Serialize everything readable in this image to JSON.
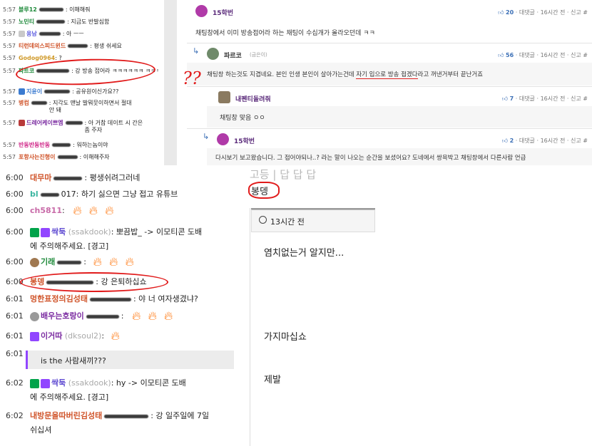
{
  "small_chat": {
    "rows": [
      {
        "time": "5:57",
        "name": "블루12",
        "name_color": "#1e8a3a",
        "msg": ": 이해해줘"
      },
      {
        "time": "5:57",
        "name": "노민티",
        "name_color": "#1e8a3a",
        "msg": ": 지금도 반발심함"
      },
      {
        "time": "5:57",
        "name": "웅남",
        "name_color": "#5b5be0",
        "msg": ": 아 ㅡㅡ"
      },
      {
        "time": "5:57",
        "name": "티런데의스피드윈드",
        "name_color": "#d0542a",
        "msg": ": 평생 쉬세요"
      },
      {
        "time": "5:57",
        "name": "Godog0964",
        "name_color": "#d09a2a",
        "msg": ": ?"
      },
      {
        "time": "5:57",
        "name": "파트코",
        "name_color": "#1e8a3a",
        "msg": ": 강 방송 접어라 ㅋㅋㅋㅋㅋㅋ ㅋㅋㅋ"
      },
      {
        "time": "5:57",
        "name": "지윤이",
        "name_color": "#3b7bd0",
        "msg": ": 공유원이신가요??"
      },
      {
        "time": "5:57",
        "name": "병컴",
        "name_color": "#d0542a",
        "msg": ": 지각도 맨날 발뭐뭇이하면서 절대안 돼"
      },
      {
        "time": "5:57",
        "name": "드레어케이쁘엠",
        "name_color": "#7a2aa0",
        "msg": ": 아 거참 데이트 시 간은 좀 주자"
      },
      {
        "time": "5:57",
        "name": "반동반동반동",
        "name_color": "#d02a8a",
        "msg": ": 워하는놈이야"
      },
      {
        "time": "5:57",
        "name": "포항사는진형이",
        "name_color": "#d0542a",
        "msg": ": 이해해주자"
      }
    ]
  },
  "thread": {
    "comments": [
      {
        "nick": "15학번",
        "likes": "20",
        "reply_label": "대댓글",
        "time": "16시간 전",
        "report": "신고",
        "text": "채팅창에서 이미 방송접어라 하는 채팅이 수십개가 올라오던데 ㅋㅋ"
      },
      {
        "nick": "파르코",
        "sub": "(금은이)",
        "likes": "56",
        "reply_label": "대댓글",
        "time": "16시간 전",
        "report": "신고",
        "text_a": "채팅창 하는것도 지겹네요. 본인 인생 본인이 살아가는건데 ",
        "text_b": "자기 입으로 방송 접겠다",
        "text_c": "라고 꺼낸거부터 끝난거죠"
      },
      {
        "nick": "내펜티돌려줘",
        "likes": "7",
        "reply_label": "대댓글",
        "time": "16시간 전",
        "report": "신고",
        "text": "채팅창 맞음 ㅇㅇ"
      },
      {
        "nick": "15학번",
        "likes": "2",
        "reply_label": "대댓글",
        "time": "16시간 전",
        "report": "신고",
        "text": "다시보기 보고왔습니다. 그 접어야되나..? 라는 말이 나오는 순간을 보셨어요? 도네에서 쌍욕박고 채팅창에서 다른사람 언급"
      }
    ],
    "hash": "#",
    "annotation": "??"
  },
  "large_chat": {
    "rows": [
      {
        "time": "6:00",
        "name": "대무마",
        "name_color": "#d0542a",
        "msg": ": 평생쉬려그러네"
      },
      {
        "time": "6:00",
        "name": "bl",
        "name_color": "#3bb5a0",
        "msg": "017: 하기 싫으면 그냥 접고 유튜브"
      },
      {
        "time": "6:00",
        "name": "ch5811",
        "name_color": "#c86aa8",
        "msg": ":"
      },
      {
        "time": "6:00",
        "name": "싹둑",
        "sub": "(ssakdook)",
        "name_color": "#5b46d0",
        "msg": ": 뽀끔밥_ -> 이모티콘 도배"
      },
      {
        "time": "",
        "name": "",
        "msg": "에 주의해주세요. [경고]"
      },
      {
        "time": "6:00",
        "name": "기래",
        "name_color": "#1e8a3a",
        "msg": ":"
      },
      {
        "time": "6:00",
        "name": "봉뎅",
        "name_color": "#d0542a",
        "msg": ": 강 은퇴하십쇼"
      },
      {
        "time": "6:01",
        "name": "멍한표정의김성태",
        "name_color": "#d0542a",
        "msg": ": 야 너 여자생겼냐?"
      },
      {
        "time": "6:01",
        "name": "배우는호랑이",
        "name_color": "#7a2aa0",
        "msg": ":"
      },
      {
        "time": "6:01",
        "name": "이거따",
        "sub": "(dksoul2)",
        "name_color": "#7a2aa0",
        "msg": ":"
      },
      {
        "time": "6:01",
        "name": "",
        "msg": ""
      },
      {
        "time": "6:02",
        "name": "싹둑",
        "sub": "(ssakdook)",
        "name_color": "#5b46d0",
        "msg": ": hy -> 이모티콘 도배"
      },
      {
        "time": "",
        "name": "",
        "msg": "에 주의해주세요. [경고]"
      },
      {
        "time": "6:02",
        "name": "내방문을따버린김성태",
        "name_color": "#d0542a",
        "msg": ": 강 일주일에 7일"
      },
      {
        "time": "",
        "name": "",
        "msg": "쉬십셔"
      }
    ],
    "quote": "is the 사람새끼???"
  },
  "detail": {
    "header_faded": "고등 | 답 답 답",
    "author": "봉뎅",
    "time_icon": "clock-icon",
    "time": "13시간 전",
    "lines": [
      "염치없는거 알지만...",
      "가지마십쇼",
      "제발"
    ]
  }
}
